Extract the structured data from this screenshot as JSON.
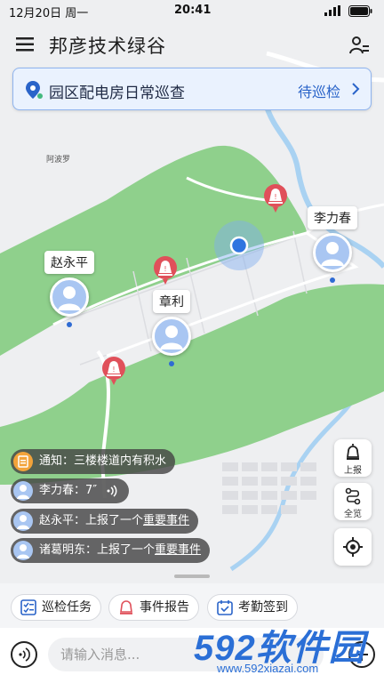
{
  "status_bar": {
    "date": "12月20日 周一",
    "time": "20:41"
  },
  "header": {
    "title": "邦彦技术绿谷",
    "menu_icon": "menu-icon",
    "user_icon": "user-list-icon"
  },
  "task_banner": {
    "title": "园区配电房日常巡查",
    "status": "待巡检"
  },
  "map": {
    "poi_label": "阿波罗",
    "personnel": [
      {
        "name": "赵永平"
      },
      {
        "name": "章利"
      },
      {
        "name": "李力春"
      }
    ]
  },
  "side_buttons": {
    "report": "上报",
    "overview": "全览"
  },
  "notifications": [
    {
      "text": "通知：三楼楼道内有积水"
    },
    {
      "text": "李力春：7″"
    },
    {
      "prefix": "赵永平：上报了一个",
      "link": "重要事件"
    },
    {
      "prefix": "诸葛明东：上报了一个",
      "link": "重要事件"
    }
  ],
  "quick_actions": {
    "patrol": "巡检任务",
    "event": "事件报告",
    "attendance": "考勤签到"
  },
  "composer": {
    "placeholder": "请输入消息..."
  },
  "watermark": {
    "brand": "592软件园",
    "url": "www.592xiazai.com"
  },
  "colors": {
    "accent": "#2a64c9",
    "park_green": "#8fd08c",
    "alarm_red": "#e0505a"
  }
}
